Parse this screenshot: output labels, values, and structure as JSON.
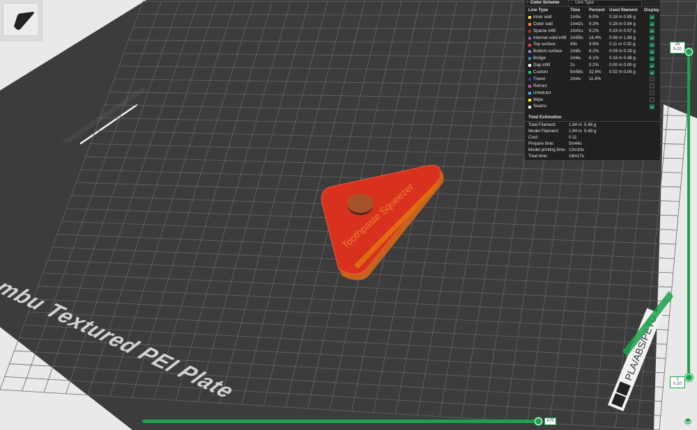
{
  "legend": {
    "title": "Color Scheme",
    "scheme_value": "Line Type",
    "columns": [
      "Line Type",
      "Time",
      "Percent",
      "Used filament",
      "Display"
    ],
    "rows": [
      {
        "name": "Inner wall",
        "time": "1m5s",
        "percent": "6.0%",
        "len": "0.28 m",
        "weight": "0.85 g",
        "color": "#ffe64d",
        "display": true
      },
      {
        "name": "Outer wall",
        "time": "1m42s",
        "percent": "9.3%",
        "len": "0.28 m",
        "weight": "0.84 g",
        "color": "#ff7d38",
        "display": true
      },
      {
        "name": "Sparse infill",
        "time": "1m41s",
        "percent": "9.2%",
        "len": "0.33 m",
        "weight": "0.97 g",
        "color": "#b03029",
        "display": true
      },
      {
        "name": "Internal solid infill",
        "time": "2m59s",
        "percent": "16.4%",
        "len": "0.56 m",
        "weight": "1.68 g",
        "color": "#9654cc",
        "display": true
      },
      {
        "name": "Top surface",
        "time": "43s",
        "percent": "3.9%",
        "len": "0.11 m",
        "weight": "0.32 g",
        "color": "#f04040",
        "display": true
      },
      {
        "name": "Bottom surface",
        "time": "1m8s",
        "percent": "6.2%",
        "len": "0.09 m",
        "weight": "0.28 g",
        "color": "#7d8ae6",
        "display": true
      },
      {
        "name": "Bridge",
        "time": "1m6s",
        "percent": "6.1%",
        "len": "0.16 m",
        "weight": "0.48 g",
        "color": "#4d80ba",
        "display": true
      },
      {
        "name": "Gap infill",
        "time": "2s",
        "percent": "0.2%",
        "len": "0.00 m",
        "weight": "0.00 g",
        "color": "#ffffff",
        "display": true
      },
      {
        "name": "Custom",
        "time": "5m58s",
        "percent": "32.6%",
        "len": "0.02 m",
        "weight": "0.06 g",
        "color": "#00d96b",
        "display": true
      },
      {
        "name": "Travel",
        "time": "2m4s",
        "percent": "11.4%",
        "len": "",
        "weight": "",
        "color": "#383899",
        "display": false
      },
      {
        "name": "Retract",
        "time": "",
        "percent": "",
        "len": "",
        "weight": "",
        "color": "#e632e6",
        "display": false
      },
      {
        "name": "Unretract",
        "time": "",
        "percent": "",
        "len": "",
        "weight": "",
        "color": "#33b4e6",
        "display": false
      },
      {
        "name": "Wipe",
        "time": "",
        "percent": "",
        "len": "",
        "weight": "",
        "color": "#ffff00",
        "display": false
      },
      {
        "name": "Seams",
        "time": "",
        "percent": "",
        "len": "",
        "weight": "",
        "color": "#ececec",
        "display": true
      }
    ]
  },
  "estimation": {
    "title": "Total Estimation",
    "rows": [
      {
        "label": "Total Filament:",
        "v1": "1.84 m",
        "v2": "5.48 g"
      },
      {
        "label": "Model Filament:",
        "v1": "1.84 m",
        "v2": "5.48 g"
      },
      {
        "label": "Cost:",
        "v1": "0.11",
        "v2": ""
      },
      {
        "label": "Prepare time:",
        "v1": "5m44s",
        "v2": ""
      },
      {
        "label": "Model printing time:",
        "v1": "12m33s",
        "v2": ""
      },
      {
        "label": "Total time:",
        "v1": "18m17s",
        "v2": ""
      }
    ]
  },
  "plate": {
    "label": "mbu Textured PEI Plate",
    "filament_label": "PLA/ABS/PETG",
    "model_text": "Toothpaste Squeezer"
  },
  "vslider": {
    "top_layer": "26",
    "top_height": "5.20",
    "bottom_layer": "1",
    "bottom_height": "0.20"
  },
  "hslider": {
    "move_value": "475"
  },
  "colors": {
    "accent": "#1aa34a",
    "plate": "#3c3c3c",
    "grid": "#6a6a6a",
    "model": "#d8321e",
    "model_edge": "#e06a10"
  }
}
